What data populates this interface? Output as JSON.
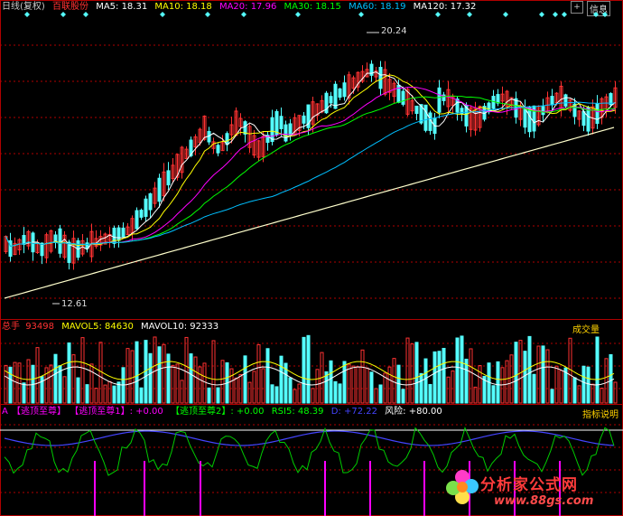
{
  "main": {
    "period": "日线(复权)",
    "stock": "百联股份",
    "ma": [
      {
        "label": "MA5: 18.31",
        "color": "#ffffff"
      },
      {
        "label": "MA10: 18.18",
        "color": "#ffff00"
      },
      {
        "label": "MA20: 17.96",
        "color": "#ff00ff"
      },
      {
        "label": "MA30: 18.15",
        "color": "#00ff00"
      },
      {
        "label": "MA60: 18.19",
        "color": "#00bfff"
      },
      {
        "label": "MA120: 17.32",
        "color": "#ffffff"
      }
    ],
    "high_label": "20.24",
    "low_label": "12.61",
    "toolbar": {
      "zoom_label": "+",
      "info_label": "信息"
    }
  },
  "volume": {
    "name": "总手",
    "value": "93498",
    "mavol5": "MAVOL5: 84630",
    "mavol10": "MAVOL10: 92333",
    "indicator_button": "成交量"
  },
  "indicator": {
    "prefix": "A",
    "items": [
      {
        "label": "【逃顶至尊】",
        "color": "#ff00ff"
      },
      {
        "label": "【逃顶至尊1】: +0.00",
        "color": "#ff00ff"
      },
      {
        "label": "【逃顶至尊2】: +0.00",
        "color": "#00ff00"
      },
      {
        "label": "RSI5: 48.39",
        "color": "#00ff00"
      },
      {
        "label": "D: +72.22",
        "color": "#4444ff"
      },
      {
        "label": "风险: +80.00",
        "color": "#ffffff"
      }
    ],
    "help_button": "指标说明"
  },
  "watermark": {
    "title": "分析家公式网",
    "url": "www.88gs.com"
  },
  "colors": {
    "up": "#ff3232",
    "down": "#54ffff",
    "grid": "#b00000",
    "ma120": "#ffffcc"
  }
}
